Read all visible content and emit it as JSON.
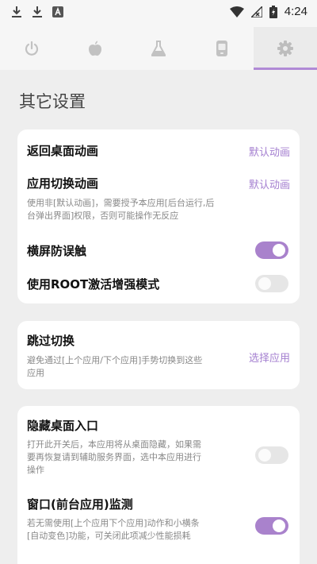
{
  "status_bar": {
    "time": "4:24"
  },
  "tabs": [
    {
      "icon": "power-icon"
    },
    {
      "icon": "apple-icon"
    },
    {
      "icon": "flask-icon"
    },
    {
      "icon": "phone-icon"
    },
    {
      "icon": "gear-icon",
      "active": true
    }
  ],
  "page": {
    "title": "其它设置"
  },
  "card1": {
    "back_home_anim": {
      "title": "返回桌面动画",
      "value": "默认动画"
    },
    "app_switch_anim": {
      "title": "应用切换动画",
      "value": "默认动画",
      "desc_line1": "使用非[默认动画]，需要授予本应用[后台运行,后",
      "desc_line2": "台弹出界面]权限，否则可能操作无反应"
    },
    "landscape_protect": {
      "title": "横屏防误触",
      "enabled": true
    },
    "root_mode": {
      "title": "使用ROOT激活增强模式",
      "enabled": false
    }
  },
  "card2": {
    "skip_switch": {
      "title": "跳过切换",
      "desc_line1": "避免通过[上个应用/下个应用]手势切换到这些",
      "desc_line2": "应用",
      "action": "选择应用"
    }
  },
  "card3": {
    "hide_launcher": {
      "title": "隐藏桌面入口",
      "desc_line1": "打开此开关后，本应用将从桌面隐藏，如果需",
      "desc_line2": "要再恢复请到辅助服务界面，选中本应用进行",
      "desc_line3": "操作",
      "enabled": false
    },
    "window_monitor": {
      "title": "窗口(前台应用)监测",
      "desc_line1": "若无需使用[上个应用下个应用]动作和小横条",
      "desc_line2": "[自动变色]功能，可关闭此项减少性能损耗",
      "enabled": true
    }
  },
  "colors": {
    "accent": "#a982cc",
    "toggle_off": "#e6e6e6",
    "background": "#eeeeee"
  }
}
